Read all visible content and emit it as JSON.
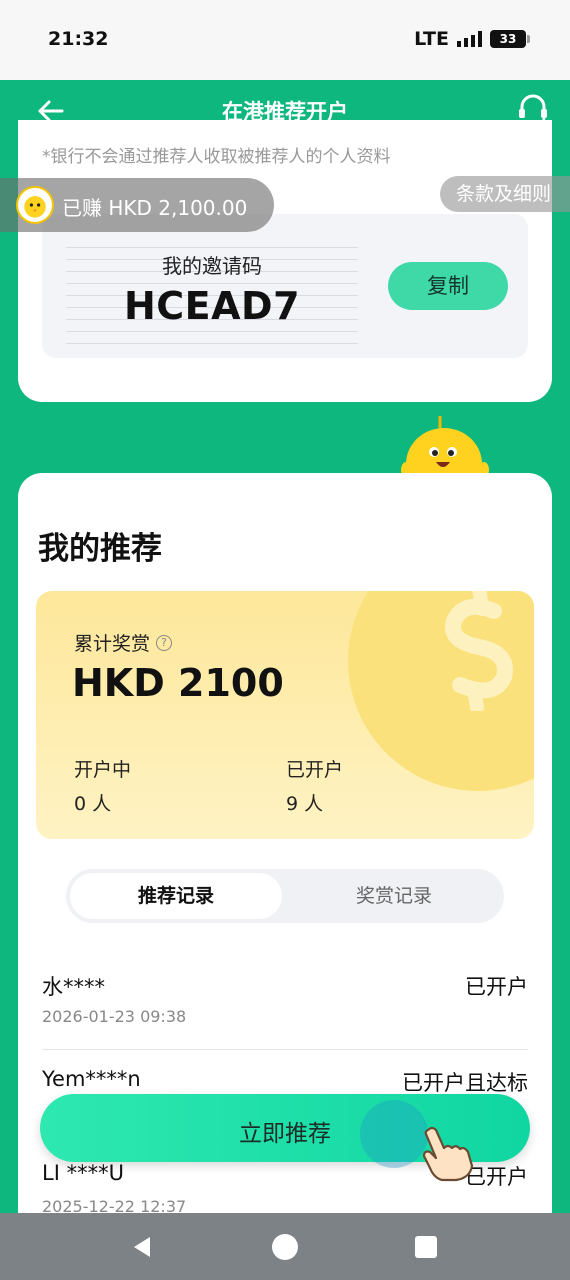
{
  "status_bar": {
    "time": "21:32",
    "network": "LTE",
    "battery": "33"
  },
  "header": {
    "title": "在港推荐开户",
    "back_icon": "arrow-left-icon",
    "support_icon": "headset-icon"
  },
  "invite": {
    "disclaimer": "*银行不会通过推荐人收取被推荐人的个人资料",
    "label": "我的邀请码",
    "code": "HCEAD7",
    "copy_label": "复制"
  },
  "overlay": {
    "earned": "已赚 HKD 2,100.00",
    "terms": "条款及细则"
  },
  "referrals": {
    "title": "我的推荐",
    "reward_label": "累计奖赏",
    "reward_amount": "HKD 2100",
    "opening_label": "开户中",
    "opening_value": "0 人",
    "opened_label": "已开户",
    "opened_value": "9 人",
    "tabs": [
      {
        "label": "推荐记录",
        "active": true
      },
      {
        "label": "奖赏记录",
        "active": false
      }
    ],
    "records": [
      {
        "name": "水****",
        "status": "已开户",
        "date": "2026-01-23 09:38"
      },
      {
        "name": "Yem****n",
        "status": "已开户且达标",
        "date": ""
      },
      {
        "name": "LI ****U",
        "status": "已开户",
        "date": "2025-12-22 12:37"
      }
    ]
  },
  "cta": {
    "label": "立即推荐"
  },
  "colors": {
    "brand_green": "#0db77d",
    "accent_mint": "#3fd9a8",
    "reward_yellow": "#fde79a"
  }
}
